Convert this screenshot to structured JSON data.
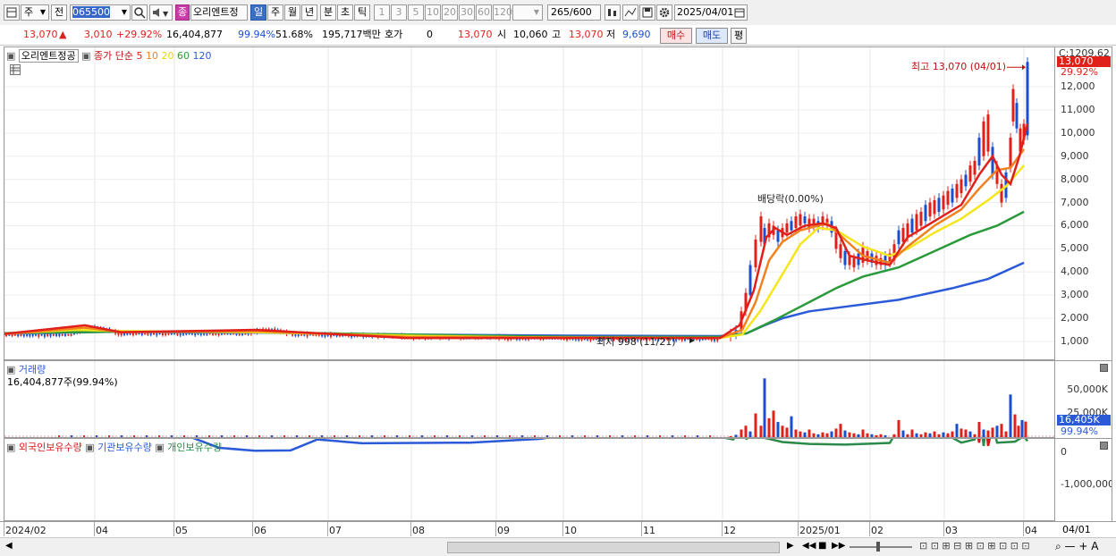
{
  "toolbar": {
    "period_options": [
      "주",
      "전"
    ],
    "stock_code": "065500",
    "stock_name": "오리엔트정",
    "badge": "종",
    "timeframes": [
      "일",
      "주",
      "월",
      "년",
      "분",
      "초",
      "틱"
    ],
    "active_timeframe": "일",
    "intervals": [
      "1",
      "3",
      "5",
      "10",
      "20",
      "30",
      "60",
      "120"
    ],
    "count": "265",
    "count_max": "/600",
    "date": "2025/04/01"
  },
  "quote": {
    "price": "13,070",
    "change": "3,010",
    "change_pct": "+29.92%",
    "volume": "16,404,877",
    "vol_ratio": "99.94%",
    "ratio2": "51.68%",
    "amount": "195,717백만",
    "hoga_label": "호가",
    "hoga_value": "0",
    "hoga_price": "13,070",
    "open_label": "시",
    "open": "10,060",
    "high_label": "고",
    "high": "13,070",
    "low_label": "저",
    "low": "9,690",
    "buy_label": "매수",
    "sell_label": "매도",
    "avg_label": "평"
  },
  "price_panel": {
    "name": "오리엔트정공",
    "ma_legend": {
      "label": "종가 단순",
      "periods": [
        "5",
        "10",
        "20",
        "60",
        "120"
      ]
    },
    "high_annotation": "최고 13,070 (04/01)",
    "low_annotation": "최저 998 (11/21)",
    "dividend_annotation": "배당락(0.00%)",
    "axis_top": "C:1209.62",
    "last_price_tag": "13,070",
    "pct_tag": "29.92%",
    "y_ticks": [
      "12,000",
      "11,000",
      "10,000",
      "9,000",
      "8,000",
      "7,000",
      "6,000",
      "5,000",
      "4,000",
      "3,000",
      "2,000",
      "1,000"
    ]
  },
  "volume_panel": {
    "title": "거래량",
    "subtitle": "16,404,877주(99.94%)",
    "y_ticks": [
      "50,000K",
      "25,000K"
    ],
    "last_tag": "16,405K",
    "pct_tag": "99.94%"
  },
  "holdings_panel": {
    "series": [
      "외국인보유수량",
      "기관보유수량",
      "개인보유수량"
    ],
    "y_ticks": [
      "0",
      "-1,000,000"
    ]
  },
  "x_axis": {
    "labels": [
      "2024/02",
      "04",
      "05",
      "06",
      "07",
      "08",
      "09",
      "10",
      "11",
      "12",
      "2025/01",
      "02",
      "03",
      "04"
    ],
    "right_label": "04/01"
  },
  "colors": {
    "up": "#e0201a",
    "down": "#1a4fd0",
    "ma5": "#e0201a",
    "ma10": "#f0821e",
    "ma20": "#f5e61c",
    "ma60": "#2a9a3a",
    "ma120": "#2a5ad8",
    "foreign": "#d81818",
    "institution": "#2a5ad8",
    "individual": "#2a8a4a"
  }
}
